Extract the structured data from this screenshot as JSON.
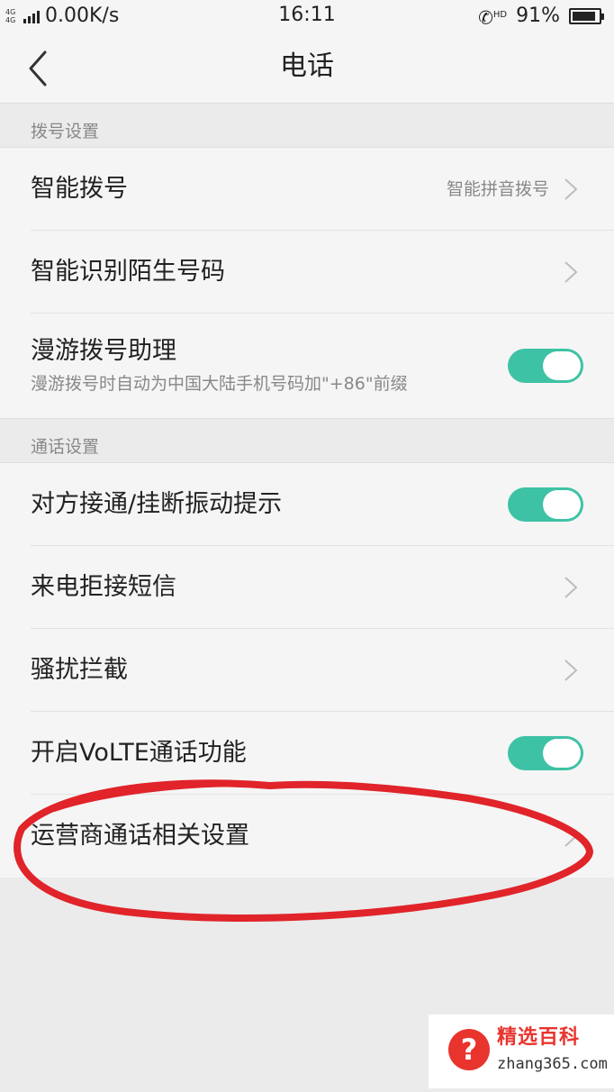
{
  "status_bar": {
    "network_type": "4G 4G",
    "net_speed": "0.00K/s",
    "time": "16:11",
    "call_indicator": "HD",
    "battery_percent": "91%",
    "battery_level": 0.91,
    "signal_icon": "signal-bars-icon",
    "call_icon": "phone-hd-icon"
  },
  "header": {
    "title": "电话",
    "back_icon": "chevron-left-icon"
  },
  "sections": [
    {
      "header": "拨号设置",
      "items": [
        {
          "title": "智能拨号",
          "value": "智能拼音拨号",
          "control": "chevron"
        },
        {
          "title": "智能识别陌生号码",
          "control": "chevron"
        },
        {
          "title": "漫游拨号助理",
          "subtitle": "漫游拨号时自动为中国大陆手机号码加\"+86\"前缀",
          "control": "toggle",
          "enabled": true
        }
      ]
    },
    {
      "header": "通话设置",
      "items": [
        {
          "title": "对方接通/挂断振动提示",
          "control": "toggle",
          "enabled": true
        },
        {
          "title": "来电拒接短信",
          "control": "chevron"
        },
        {
          "title": "骚扰拦截",
          "control": "chevron"
        },
        {
          "title": "开启VoLTE通话功能",
          "control": "toggle",
          "enabled": true
        },
        {
          "title": "运营商通话相关设置",
          "control": "chevron"
        }
      ]
    }
  ],
  "colors": {
    "toggle_on": "#3ec2a5",
    "annotation_ring": "#e0242a",
    "background": "#ebebeb",
    "row_background": "#f5f5f5"
  },
  "watermark": {
    "name": "精选百科",
    "domain": "zhang365.com",
    "icon": "question-mark-icon"
  }
}
